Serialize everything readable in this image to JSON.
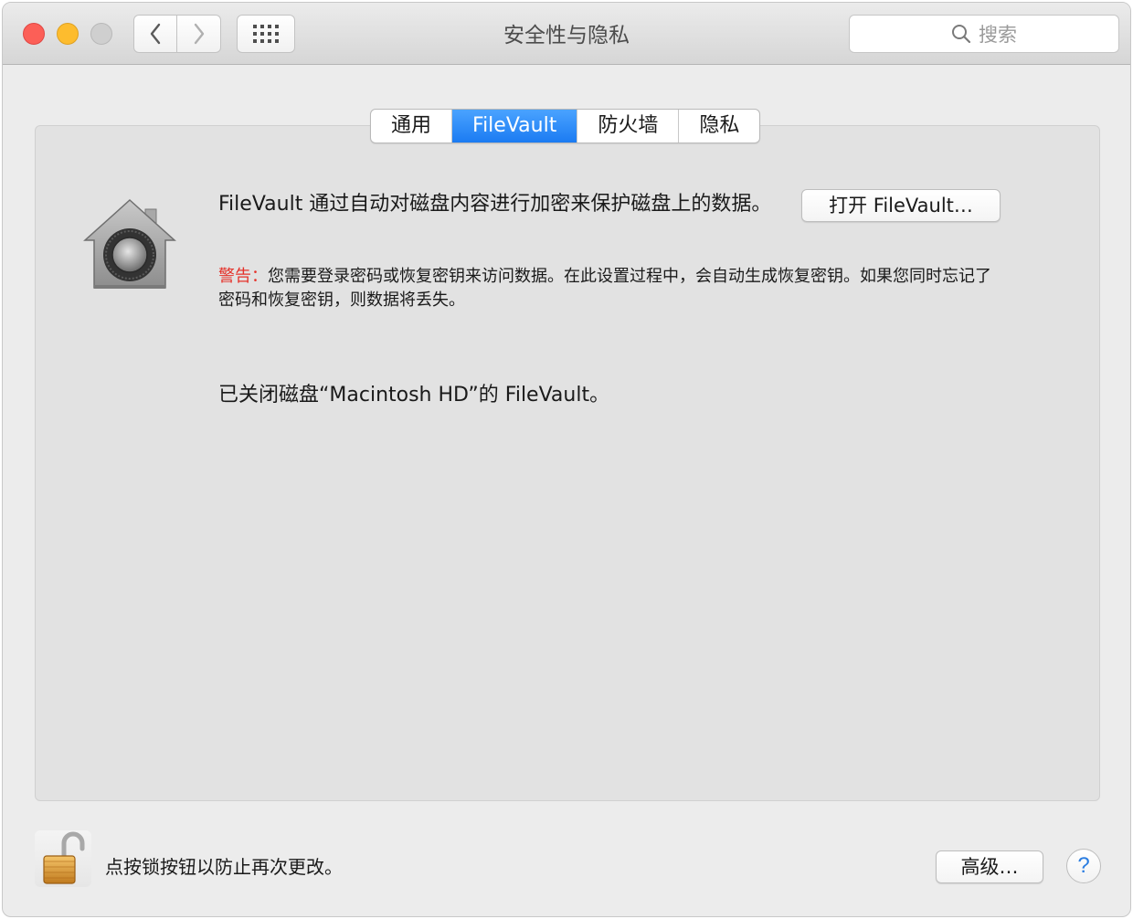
{
  "window": {
    "title": "安全性与隐私",
    "search_placeholder": "搜索"
  },
  "tabs": [
    {
      "label": "通用",
      "active": false
    },
    {
      "label": "FileVault",
      "active": true
    },
    {
      "label": "防火墙",
      "active": false
    },
    {
      "label": "隐私",
      "active": false
    }
  ],
  "filevault": {
    "description": "FileVault 通过自动对磁盘内容进行加密来保护磁盘上的数据。",
    "open_button": "打开 FileVault…",
    "warning_label": "警告：",
    "warning_text": "您需要登录密码或恢复密钥来访问数据。在此设置过程中，会自动生成恢复密钥。如果您同时忘记了密码和恢复密钥，则数据将丢失。",
    "status": "已关闭磁盘“Macintosh HD”的 FileVault。"
  },
  "footer": {
    "lock_text": "点按锁按钮以防止再次更改。",
    "advanced_button": "高级…",
    "help_label": "?"
  },
  "icons": {
    "window_controls": [
      "close-icon",
      "minimize-icon",
      "zoom-icon"
    ],
    "navigation": [
      "chevron-left-icon",
      "chevron-right-icon",
      "grid-icon"
    ],
    "search": "search-icon",
    "filevault": "filevault-house-icon",
    "lock": "padlock-open-icon"
  },
  "colors": {
    "accent": "#1b7bf2",
    "warning": "#e5322a",
    "close": "#fc5f57",
    "minimize": "#fdbc2e"
  }
}
